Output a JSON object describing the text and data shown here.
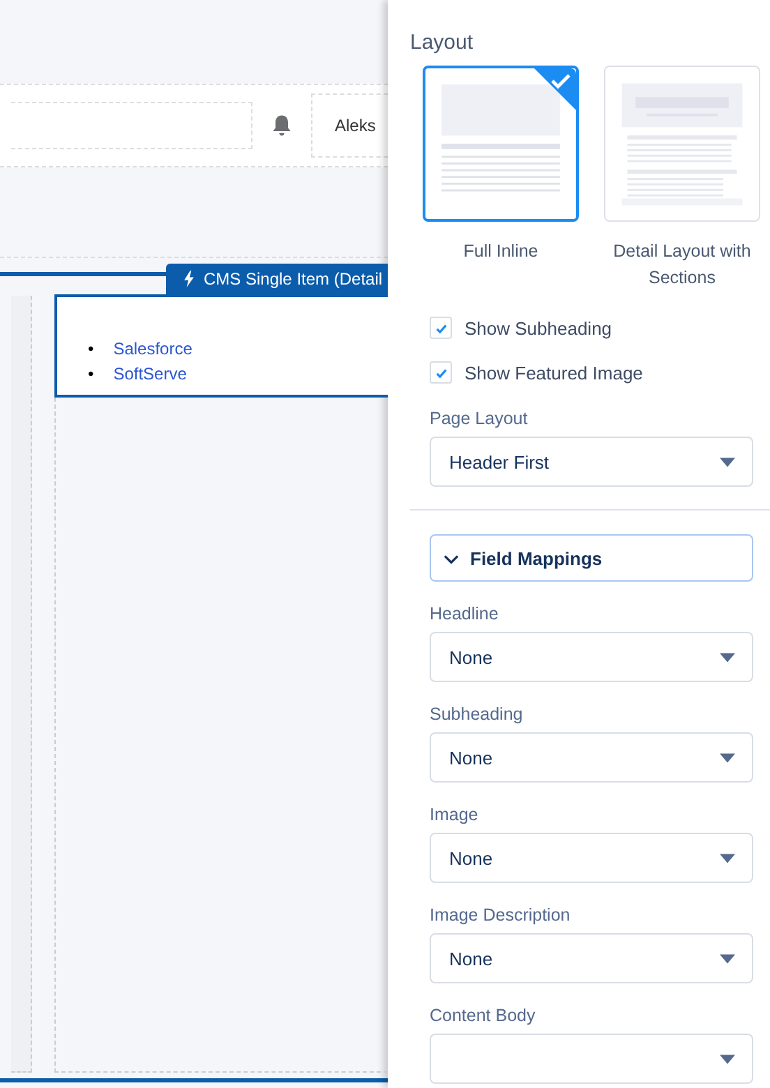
{
  "header": {
    "user_name": "Aleks"
  },
  "component": {
    "tab_label": "CMS Single Item (Detail",
    "links": [
      {
        "marker": "•",
        "label": "Salesforce"
      },
      {
        "marker": "•",
        "label": "SoftServe"
      }
    ]
  },
  "panel": {
    "title": "Layout",
    "layout_options": [
      {
        "label": "Full Inline",
        "kind": "inline",
        "selected": true
      },
      {
        "label": "Detail Layout with Sections",
        "kind": "sections",
        "selected": false
      }
    ],
    "checkboxes": [
      {
        "label": "Show Subheading",
        "checked": true
      },
      {
        "label": "Show Featured Image",
        "checked": true
      }
    ],
    "page_layout": {
      "label": "Page Layout",
      "value": "Header First"
    },
    "field_mappings": {
      "title": "Field Mappings",
      "expanded": true,
      "fields": [
        {
          "label": "Headline",
          "value": "None"
        },
        {
          "label": "Subheading",
          "value": "None"
        },
        {
          "label": "Image",
          "value": "None"
        },
        {
          "label": "Image Description",
          "value": "None"
        },
        {
          "label": "Content Body"
        }
      ]
    }
  }
}
